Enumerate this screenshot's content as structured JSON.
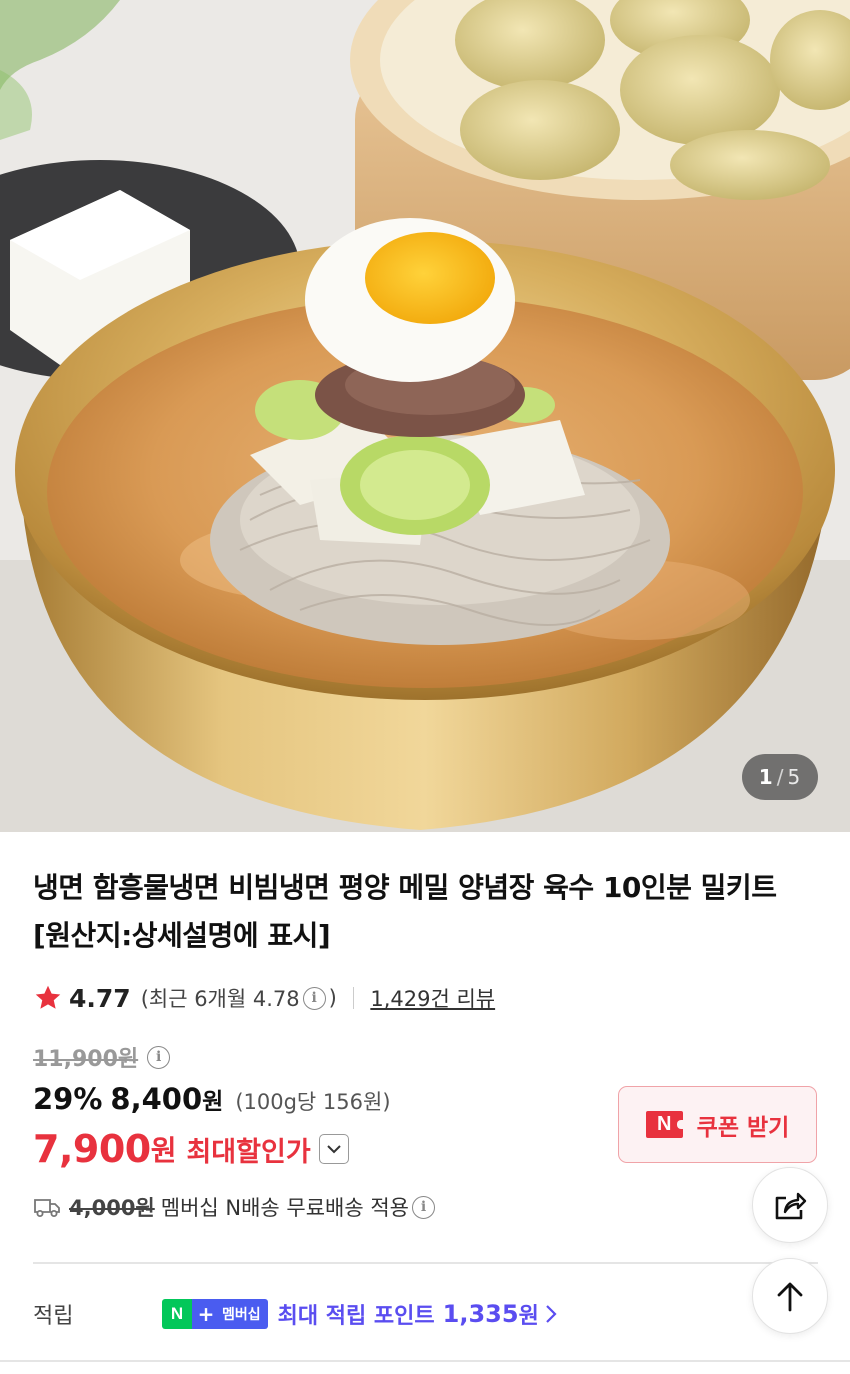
{
  "gallery": {
    "current": "1",
    "separator": "/",
    "total": "5",
    "image_icon": "naengmyeon-bowl-photo"
  },
  "product": {
    "title": "냉면 함흥물냉면 비빔냉면 평양 메밀 양념장 육수 10인분 밀키트 [원산지:상세설명에 표시]",
    "rating": "4.77",
    "recent_rating": "(최근 6개월 4.78",
    "recent_close": ")",
    "review_count": "1,429건 리뷰",
    "original_price": "11,900원",
    "discount_rate": "29%",
    "sale_price": "8,400",
    "sale_won": "원",
    "unit_price": "(100g당 156원)",
    "max_discount_price": "7,900",
    "max_discount_won": "원",
    "max_discount_label": "최대할인가"
  },
  "coupon": {
    "badge": "N",
    "label": "쿠폰 받기"
  },
  "shipping": {
    "original_fee": "4,000원",
    "text": "멤버십 N배송 무료배송 적용"
  },
  "points": {
    "label": "적립",
    "badge_n": "N",
    "badge_plus": "+",
    "badge_text": "멤버십",
    "text": "최대 적립 포인트",
    "value": "1,335",
    "won": "원"
  },
  "colors": {
    "accent_red": "#e8323e",
    "point_purple": "#5a4df0",
    "naver_green": "#03c75a"
  },
  "icons": [
    "star-icon",
    "info-icon",
    "chevron-down-icon",
    "truck-icon",
    "share-icon",
    "arrow-up-icon",
    "chevron-right-icon"
  ]
}
